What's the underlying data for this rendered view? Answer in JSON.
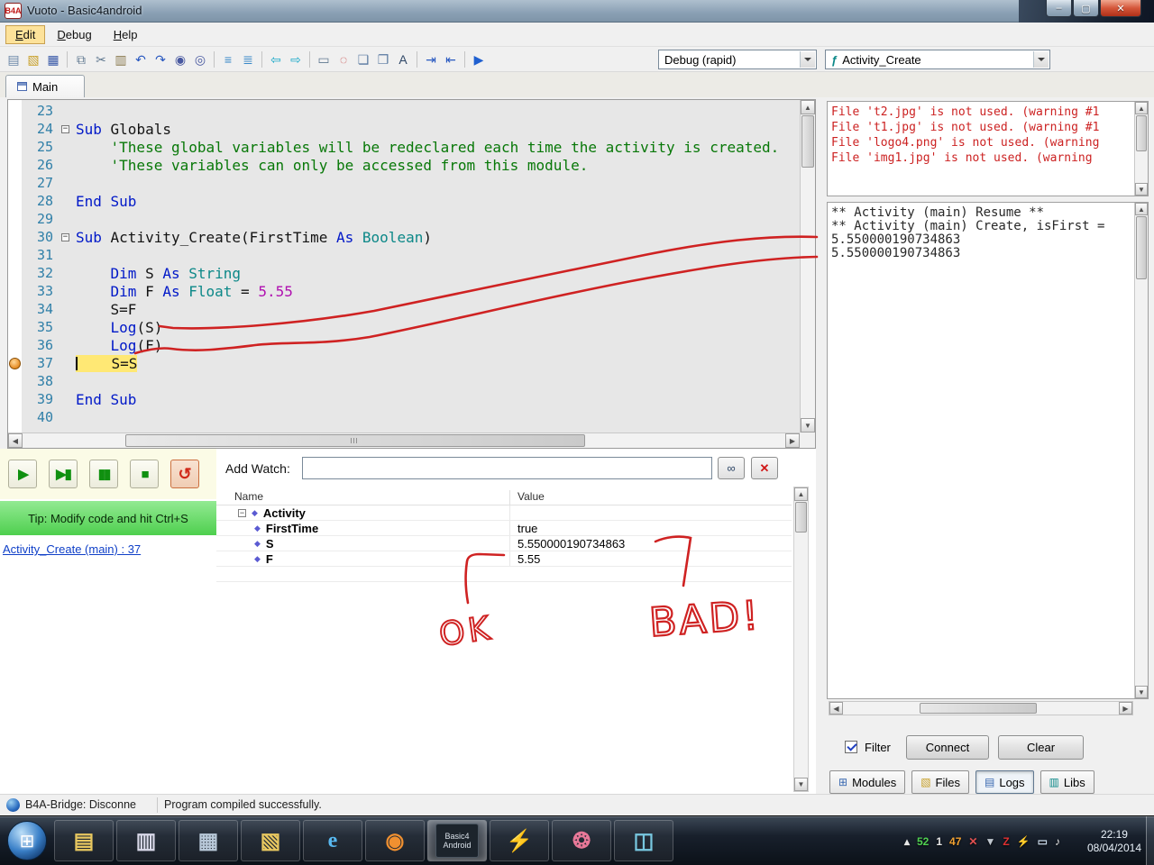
{
  "window": {
    "badge": "B4A",
    "title": "Vuoto - Basic4android",
    "controls": [
      {
        "n": "minimize",
        "g": "–"
      },
      {
        "n": "maximize",
        "g": "▢"
      },
      {
        "n": "close",
        "g": "✕"
      }
    ]
  },
  "menubar": {
    "items": [
      {
        "label": "Edit",
        "active": true
      },
      {
        "label": "Debug",
        "active": false
      },
      {
        "label": "Help",
        "active": false
      }
    ]
  },
  "toolbar": {
    "debug_mode": "Debug (rapid)",
    "module": "Activity_Create",
    "module_icon": "ƒ",
    "icons": [
      {
        "n": "new-file",
        "g": "▤",
        "c": "#6b87a8"
      },
      {
        "n": "open-file",
        "g": "▧",
        "c": "#c8a028"
      },
      {
        "n": "save-file",
        "g": "▦",
        "c": "#3858a8"
      },
      {
        "n": "sep"
      },
      {
        "n": "copy",
        "g": "⧉",
        "c": "#607890"
      },
      {
        "n": "cut",
        "g": "✂",
        "c": "#607890"
      },
      {
        "n": "paste",
        "g": "▥",
        "c": "#8a7a50"
      },
      {
        "n": "undo",
        "g": "↶",
        "c": "#2858c0"
      },
      {
        "n": "redo",
        "g": "↷",
        "c": "#2858c0"
      },
      {
        "n": "find",
        "g": "◉",
        "c": "#4858a0"
      },
      {
        "n": "find-next",
        "g": "◎",
        "c": "#4858a0"
      },
      {
        "n": "sep"
      },
      {
        "n": "sort-ascending",
        "g": "≡",
        "c": "#3888c8"
      },
      {
        "n": "sort-descending",
        "g": "≣",
        "c": "#3888c8"
      },
      {
        "n": "sep"
      },
      {
        "n": "navigate-back",
        "g": "⇦",
        "c": "#18a8c8"
      },
      {
        "n": "navigate-forward",
        "g": "⇨",
        "c": "#18a8c8"
      },
      {
        "n": "sep"
      },
      {
        "n": "select-rectangle",
        "g": "▭",
        "c": "#607890"
      },
      {
        "n": "zoom",
        "g": "◌",
        "c": "#c03030"
      },
      {
        "n": "comment",
        "g": "❏",
        "c": "#5878a0"
      },
      {
        "n": "uncomment",
        "g": "❐",
        "c": "#5878a0"
      },
      {
        "n": "font-tool",
        "g": "A",
        "c": "#304868"
      },
      {
        "n": "sep"
      },
      {
        "n": "indent",
        "g": "⇥",
        "c": "#2858c0"
      },
      {
        "n": "outdent",
        "g": "⇤",
        "c": "#2858c0"
      },
      {
        "n": "sep"
      },
      {
        "n": "run",
        "g": "▶",
        "c": "#2060d0"
      }
    ]
  },
  "tabstrip": {
    "tabs": [
      {
        "label": "Main"
      }
    ]
  },
  "editor": {
    "lines": [
      {
        "num": "23",
        "segments": []
      },
      {
        "num": "24",
        "fold": true,
        "segments": [
          {
            "t": "Sub",
            "c": "kw"
          },
          {
            "t": " Globals",
            "c": "pl"
          }
        ]
      },
      {
        "num": "25",
        "segments": [
          {
            "t": "    'These global variables will be redeclared each time the activity is created.",
            "c": "cm"
          }
        ]
      },
      {
        "num": "26",
        "segments": [
          {
            "t": "    'These variables can only be accessed from this module.",
            "c": "cm"
          }
        ]
      },
      {
        "num": "27",
        "segments": []
      },
      {
        "num": "28",
        "segments": [
          {
            "t": "End Sub",
            "c": "kw"
          }
        ]
      },
      {
        "num": "29",
        "segments": []
      },
      {
        "num": "30",
        "fold": true,
        "segments": [
          {
            "t": "Sub",
            "c": "kw"
          },
          {
            "t": " Activity_Create(FirstTime ",
            "c": "pl"
          },
          {
            "t": "As",
            "c": "kw"
          },
          {
            "t": " ",
            "c": "pl"
          },
          {
            "t": "Boolean",
            "c": "ty"
          },
          {
            "t": ")",
            "c": "pl"
          }
        ]
      },
      {
        "num": "31",
        "segments": []
      },
      {
        "num": "32",
        "segments": [
          {
            "t": "    ",
            "c": "pl"
          },
          {
            "t": "Dim",
            "c": "kw"
          },
          {
            "t": " S ",
            "c": "pl"
          },
          {
            "t": "As",
            "c": "kw"
          },
          {
            "t": " ",
            "c": "pl"
          },
          {
            "t": "String",
            "c": "ty"
          }
        ]
      },
      {
        "num": "33",
        "segments": [
          {
            "t": "    ",
            "c": "pl"
          },
          {
            "t": "Dim",
            "c": "kw"
          },
          {
            "t": " F ",
            "c": "pl"
          },
          {
            "t": "As",
            "c": "kw"
          },
          {
            "t": " ",
            "c": "pl"
          },
          {
            "t": "Float",
            "c": "ty"
          },
          {
            "t": " = ",
            "c": "pl"
          },
          {
            "t": "5.55",
            "c": "num"
          }
        ]
      },
      {
        "num": "34",
        "segments": [
          {
            "t": "    S=F",
            "c": "pl"
          }
        ]
      },
      {
        "num": "35",
        "segments": [
          {
            "t": "    ",
            "c": "pl"
          },
          {
            "t": "Log",
            "c": "kw"
          },
          {
            "t": "(S)",
            "c": "pl"
          }
        ]
      },
      {
        "num": "36",
        "segments": [
          {
            "t": "    ",
            "c": "pl"
          },
          {
            "t": "Log",
            "c": "kw"
          },
          {
            "t": "(F)",
            "c": "pl"
          }
        ]
      },
      {
        "num": "37",
        "current": true,
        "segments": [
          {
            "t": "    S=S",
            "c": "pl"
          }
        ]
      },
      {
        "num": "38",
        "segments": []
      },
      {
        "num": "39",
        "segments": [
          {
            "t": "End Sub",
            "c": "kw"
          }
        ]
      },
      {
        "num": "40",
        "segments": []
      }
    ]
  },
  "debug_controls": {
    "buttons": [
      {
        "n": "run",
        "g": "▶"
      },
      {
        "n": "step",
        "g": "▶▮"
      },
      {
        "n": "pause",
        "g": "▮▮"
      },
      {
        "n": "stop",
        "g": "■"
      },
      {
        "n": "restart",
        "g": "↺",
        "red": true
      }
    ]
  },
  "tip": {
    "text": "Tip: Modify code and hit Ctrl+S",
    "link": "Activity_Create (main) : 37"
  },
  "watch": {
    "label": "Add Watch:",
    "find_icon": "∞",
    "clear_icon": "✕",
    "columns": [
      "Name",
      "Value"
    ],
    "rows": [
      {
        "name": "Activity",
        "value": "",
        "indent": 0,
        "expander": true
      },
      {
        "name": "FirstTime",
        "value": "true",
        "indent": 1
      },
      {
        "name": "S",
        "value": "5.550000190734863",
        "indent": 1
      },
      {
        "name": "F",
        "value": "5.55",
        "indent": 1
      }
    ]
  },
  "logs": {
    "warnings": [
      "File 't2.jpg' is not used. (warning #1",
      "File 't1.jpg' is not used. (warning #1",
      "File 'logo4.png' is not used. (warning",
      "File 'img1.jpg' is not used. (warning"
    ],
    "output": [
      "** Activity (main) Resume **",
      "** Activity (main) Create, isFirst =",
      "5.550000190734863",
      "5.550000190734863"
    ],
    "filter_label": "Filter",
    "connect_label": "Connect",
    "clear_label": "Clear",
    "tabs": [
      {
        "label": "Modules",
        "icon": "⊞",
        "color": "#3868b0",
        "active": false
      },
      {
        "label": "Files",
        "icon": "▧",
        "color": "#c8a028",
        "active": false
      },
      {
        "label": "Logs",
        "icon": "▤",
        "color": "#3868b0",
        "active": true
      },
      {
        "label": "Libs",
        "icon": "▥",
        "color": "#0c8888",
        "active": false
      }
    ]
  },
  "statusbar": {
    "bridge": "B4A-Bridge: Disconne",
    "message": "Program compiled successfully."
  },
  "taskbar": {
    "start_glyph": "⊞",
    "buttons": [
      {
        "n": "libraries",
        "g": "▤",
        "c": "#e8c860"
      },
      {
        "n": "explorer",
        "g": "▥",
        "c": "#d8d8e8"
      },
      {
        "n": "calculator",
        "g": "▦",
        "c": "#b8c8d8"
      },
      {
        "n": "folder",
        "g": "▧",
        "c": "#e8c860"
      },
      {
        "n": "internet-explorer",
        "g": "e",
        "c": "#58b8f0"
      },
      {
        "n": "firefox",
        "g": "◉",
        "c": "#f09030"
      },
      {
        "n": "basic4android",
        "l1": "Basic4",
        "l2": "Android",
        "active": true
      },
      {
        "n": "designer",
        "g": "⚡",
        "c": "#f0d040"
      },
      {
        "n": "paint",
        "g": "❂",
        "c": "#e87898"
      },
      {
        "n": "photo-viewer",
        "g": "◫",
        "c": "#78c8e0"
      }
    ],
    "tray": [
      {
        "n": "hidden-icons",
        "g": "▴",
        "c": "#e8e8e8"
      },
      {
        "n": "meter-green",
        "g": "52",
        "c": "#50d050"
      },
      {
        "n": "meter-white",
        "g": "1",
        "c": "#e8e8e8"
      },
      {
        "n": "meter-orange",
        "g": "47",
        "c": "#f0a030"
      },
      {
        "n": "action-center",
        "g": "✕",
        "c": "#e05050"
      },
      {
        "n": "update",
        "g": "▼",
        "c": "#c0c8d0"
      },
      {
        "n": "antivirus",
        "g": "Z",
        "c": "#e03030"
      },
      {
        "n": "bridge",
        "g": "⚡",
        "c": "#f0f0f0"
      },
      {
        "n": "display",
        "g": "▭",
        "c": "#c8d8e8"
      },
      {
        "n": "volume",
        "g": "♪",
        "c": "#f0f0f0"
      }
    ],
    "clock_time": "22:19",
    "clock_date": "08/04/2014"
  },
  "annotations": {
    "ok": "OK",
    "bad": "BAD!"
  }
}
